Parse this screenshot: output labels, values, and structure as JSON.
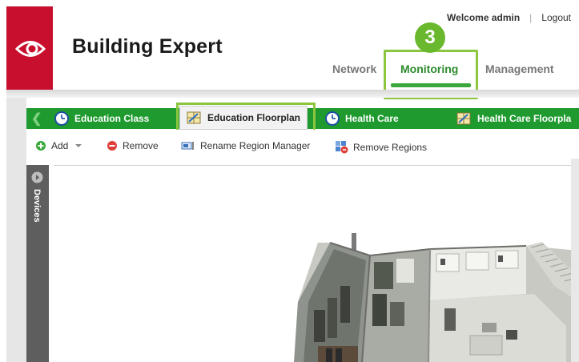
{
  "header": {
    "app_title": "Building Expert",
    "welcome": "Welcome admin",
    "logout": "Logout",
    "logo_color": "#c8102e"
  },
  "nav": {
    "network": "Network",
    "monitoring": "Monitoring",
    "management": "Management",
    "active": "Monitoring",
    "accent": "#3aa83a"
  },
  "callout": {
    "step": "3",
    "color": "#8cc63f"
  },
  "floorplan_tabs": [
    {
      "label": "Education Class",
      "icon": "clock-icon"
    },
    {
      "label": "Education Floorplan",
      "icon": "floorplan-icon",
      "active": true
    },
    {
      "label": "Health Care",
      "icon": "clock-icon"
    },
    {
      "label": "Health Care Floorpla",
      "icon": "floorplan-icon"
    }
  ],
  "toolbar": {
    "add": "Add",
    "remove": "Remove",
    "rename": "Rename Region Manager",
    "remove_regions": "Remove Regions"
  },
  "side_panel": {
    "label": "Devices"
  }
}
